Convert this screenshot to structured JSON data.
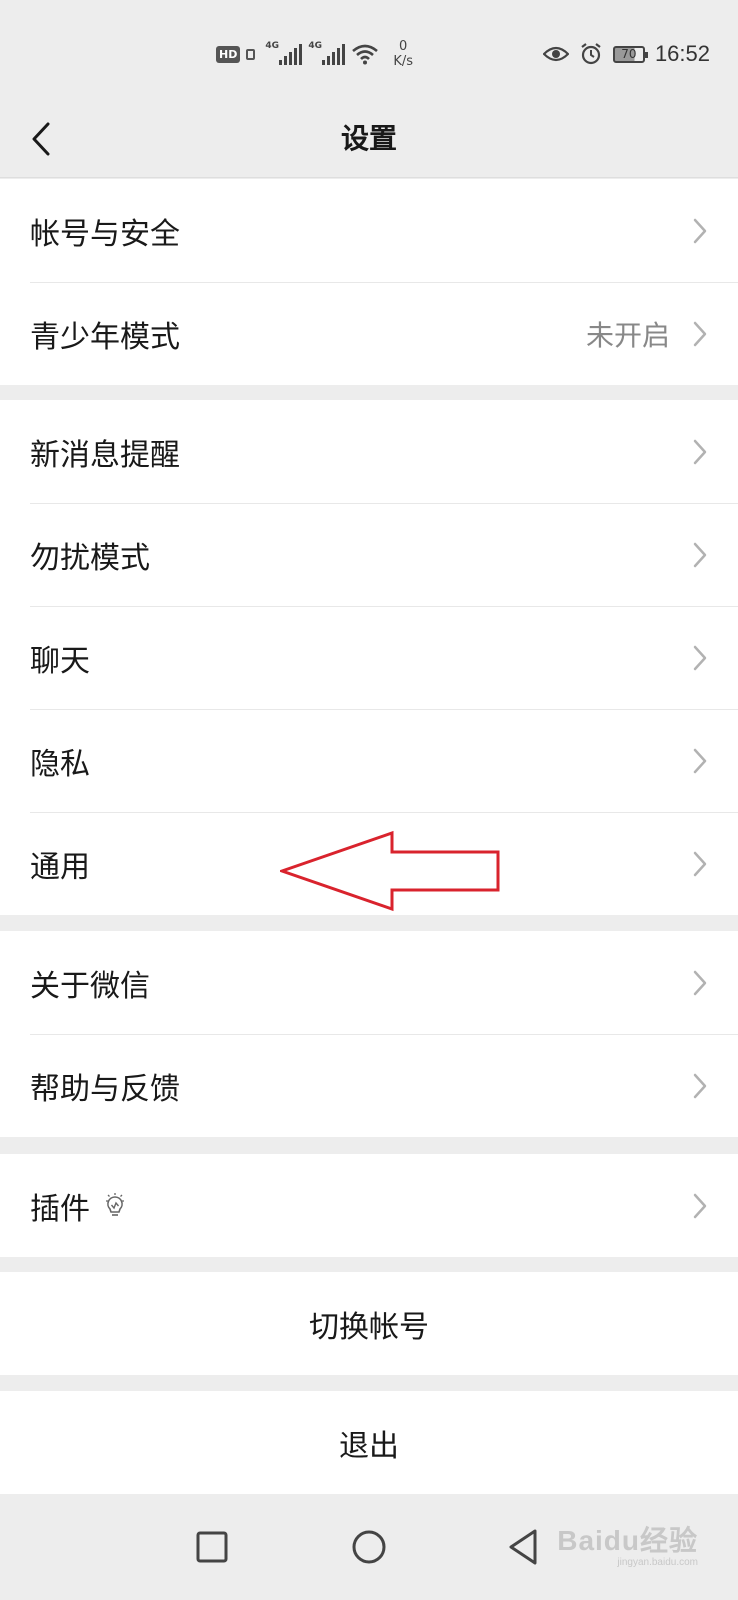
{
  "status_bar": {
    "hd_badge": "HD",
    "signal_1_type": "4G",
    "signal_2_type": "4G",
    "net_speed_value": "0",
    "net_speed_unit": "K/s",
    "battery_level": "70",
    "time": "16:52"
  },
  "navbar": {
    "title": "设置",
    "back_icon": "chevron-left-icon"
  },
  "groups": [
    {
      "items": [
        {
          "label": "帐号与安全",
          "value": ""
        },
        {
          "label": "青少年模式",
          "value": "未开启"
        }
      ]
    },
    {
      "items": [
        {
          "label": "新消息提醒",
          "value": ""
        },
        {
          "label": "勿扰模式",
          "value": ""
        },
        {
          "label": "聊天",
          "value": ""
        },
        {
          "label": "隐私",
          "value": ""
        },
        {
          "label": "通用",
          "value": ""
        }
      ]
    },
    {
      "items": [
        {
          "label": "关于微信",
          "value": ""
        },
        {
          "label": "帮助与反馈",
          "value": ""
        }
      ]
    },
    {
      "items": [
        {
          "label": "插件",
          "value": "",
          "icon": "lightbulb-icon"
        }
      ]
    }
  ],
  "actions": {
    "switch_account": "切换帐号",
    "logout": "退出"
  },
  "annotation": {
    "arrow_color": "#d9232d",
    "points_to": "通用"
  },
  "watermark": {
    "text": "Baidu经验",
    "url_text": "jingyan.baidu.com"
  },
  "colors": {
    "background": "#ededed",
    "card": "#ffffff",
    "text": "#191919",
    "secondary_text": "#888888"
  }
}
